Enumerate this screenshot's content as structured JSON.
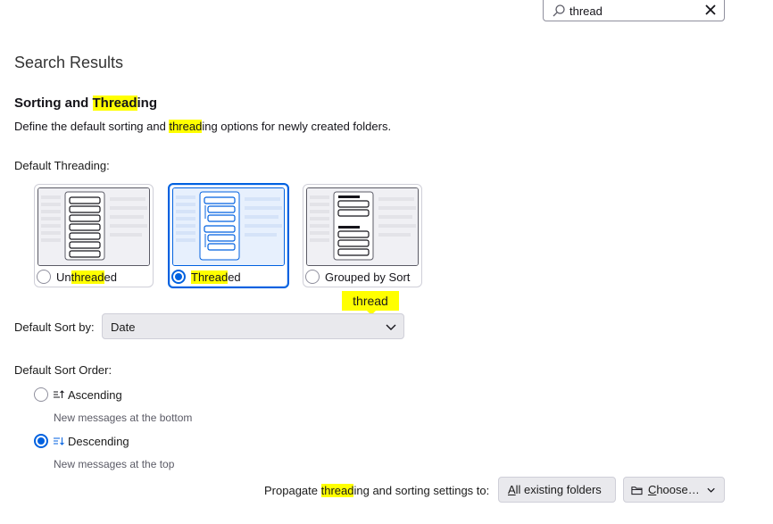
{
  "search": {
    "value": "thread"
  },
  "page": {
    "results_title": "Search Results"
  },
  "section": {
    "title_pre": "Sorting and ",
    "title_hl": "Thread",
    "title_post": "ing",
    "desc_pre": "Define the default sorting and ",
    "desc_hl": "thread",
    "desc_post": "ing options for newly created folders."
  },
  "threading": {
    "label": "Default Threading:",
    "options": [
      {
        "pre": "Un",
        "hl": "thread",
        "post": "ed",
        "checked": false
      },
      {
        "pre": "",
        "hl": "Thread",
        "post": "ed",
        "checked": true
      },
      {
        "pre": "Grouped by Sort",
        "hl": "",
        "post": "",
        "checked": false
      }
    ]
  },
  "tooltip": {
    "text": "thread"
  },
  "sort_by": {
    "label": "Default Sort by:",
    "value": "Date"
  },
  "sort_order": {
    "label": "Default Sort Order:",
    "ascending": {
      "label": "Ascending",
      "hint": "New messages at the bottom",
      "checked": false
    },
    "descending": {
      "label": "Descending",
      "hint": "New messages at the top",
      "checked": true
    }
  },
  "propagate": {
    "label_pre": "Propagate ",
    "label_hl": "thread",
    "label_post": "ing and sorting settings to:",
    "all_folders_accel": "A",
    "all_folders_rest": "ll existing folders",
    "choose_accel": "C",
    "choose_rest": "hoose…"
  },
  "colors": {
    "accent": "#0061e0",
    "highlight": "#ffff00"
  },
  "icons": [
    "search-icon",
    "close-icon",
    "chevron-down-icon",
    "sort-ascending-icon",
    "sort-descending-icon",
    "folder-icon"
  ]
}
